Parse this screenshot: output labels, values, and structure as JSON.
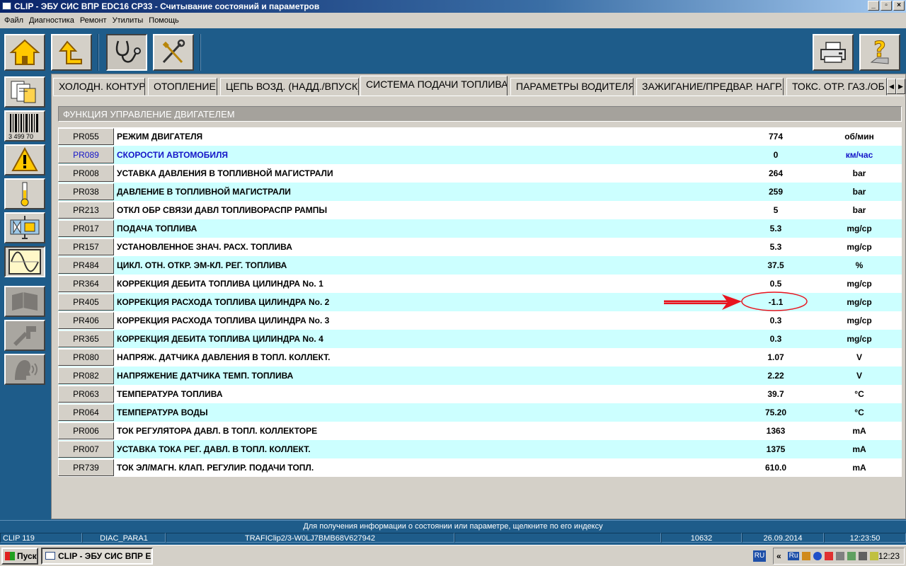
{
  "window": {
    "title": "CLIP - ЭБУ СИС ВПР EDC16 CP33 - Считывание состояний и параметров",
    "minimize": "_",
    "maximize": "▫",
    "close": "×"
  },
  "menu": [
    "Файл",
    "Диагностика",
    "Ремонт",
    "Утилиты",
    "Помощь"
  ],
  "toolbar_icons": [
    "home-icon",
    "back-arrow-icon",
    "stethoscope-icon",
    "tools-icon",
    "printer-icon",
    "help-icon"
  ],
  "sidebar_icons": [
    "documents-icon",
    "barcode-icon",
    "warning-icon",
    "thermometer-icon",
    "actuator-icon",
    "oscilloscope-icon",
    "book-icon",
    "repair-icon",
    "voice-icon"
  ],
  "barcode_text": "3 499 70",
  "tabs": [
    "ХОЛОДН. КОНТУР",
    "ОТОПЛЕНИЕ",
    "ЦЕПЬ ВОЗД. (НАДД./ВПУСК)",
    "СИСТЕМА ПОДАЧИ ТОПЛИВА",
    "ПАРАМЕТРЫ ВОДИТЕЛЯ",
    "ЗАЖИГАНИЕ/ПРЕДВАР. НАГР.",
    "ТОКС. ОТР. ГАЗ./ОБ"
  ],
  "active_tab": "СИСТЕМА ПОДАЧИ ТОПЛИВА",
  "function_header": "ФУНКЦИЯ УПРАВЛЕНИЕ ДВИГАТЕЛЕМ",
  "params": [
    {
      "code": "PR055",
      "label": "РЕЖИМ ДВИГАТЕЛЯ",
      "value": "774",
      "unit": "об/мин"
    },
    {
      "code": "PR089",
      "label": "СКОРОСТИ АВТОМОБИЛЯ",
      "value": "0",
      "unit": "км/час",
      "highlight": true
    },
    {
      "code": "PR008",
      "label": "УСТАВКА ДАВЛЕНИЯ В ТОПЛИВНОЙ МАГИСТРАЛИ",
      "value": "264",
      "unit": "bar"
    },
    {
      "code": "PR038",
      "label": "ДАВЛЕНИЕ В ТОПЛИВНОЙ МАГИСТРАЛИ",
      "value": "259",
      "unit": "bar"
    },
    {
      "code": "PR213",
      "label": "ОТКЛ ОБР СВЯЗИ ДАВЛ ТОПЛИВОРАСПР РАМПЫ",
      "value": "5",
      "unit": "bar"
    },
    {
      "code": "PR017",
      "label": "ПОДАЧА ТОПЛИВА",
      "value": "5.3",
      "unit": "mg/cp"
    },
    {
      "code": "PR157",
      "label": "УСТАНОВЛЕННОЕ ЗНАЧ. РАСХ. ТОПЛИВА",
      "value": "5.3",
      "unit": "mg/cp"
    },
    {
      "code": "PR484",
      "label": "ЦИКЛ. ОТН. ОТКР. ЭМ-КЛ. РЕГ. ТОПЛИВА",
      "value": "37.5",
      "unit": "%"
    },
    {
      "code": "PR364",
      "label": "КОРРЕКЦИЯ ДЕБИТА ТОПЛИВА ЦИЛИНДРА No. 1",
      "value": "0.5",
      "unit": "mg/cp"
    },
    {
      "code": "PR405",
      "label": "КОРРЕКЦИЯ РАСХОДА ТОПЛИВА ЦИЛИНДРА No. 2",
      "value": "-1.1",
      "unit": "mg/cp"
    },
    {
      "code": "PR406",
      "label": "КОРРЕКЦИЯ РАСХОДА ТОПЛИВА ЦИЛИНДРА No. 3",
      "value": "0.3",
      "unit": "mg/cp"
    },
    {
      "code": "PR365",
      "label": "КОРРЕКЦИЯ ДЕБИТА ТОПЛИВА ЦИЛИНДРА No. 4",
      "value": "0.3",
      "unit": "mg/cp"
    },
    {
      "code": "PR080",
      "label": "НАПРЯЖ. ДАТЧИКА ДАВЛЕНИЯ В ТОПЛ. КОЛЛЕКТ.",
      "value": "1.07",
      "unit": "V"
    },
    {
      "code": "PR082",
      "label": "НАПРЯЖЕНИЕ ДАТЧИКА ТЕМП. ТОПЛИВА",
      "value": "2.22",
      "unit": "V"
    },
    {
      "code": "PR063",
      "label": "ТЕМПЕРАТУРА ТОПЛИВА",
      "value": "39.7",
      "unit": "°C"
    },
    {
      "code": "PR064",
      "label": "ТЕМПЕРАТУРА ВОДЫ",
      "value": "75.20",
      "unit": "°C"
    },
    {
      "code": "PR006",
      "label": "ТОК РЕГУЛЯТОРА ДАВЛ. В ТОПЛ. КОЛЛЕКТОРЕ",
      "value": "1363",
      "unit": "mA"
    },
    {
      "code": "PR007",
      "label": "УСТАВКА ТОКА РЕГ. ДАВЛ. В ТОПЛ. КОЛЛЕКТ.",
      "value": "1375",
      "unit": "mA"
    },
    {
      "code": "PR739",
      "label": "ТОК ЭЛ/МАГН. КЛАП. РЕГУЛИР. ПОДАЧИ ТОПЛ.",
      "value": "610.0",
      "unit": "mA"
    }
  ],
  "annotation": {
    "marked_code": "PR405",
    "color": "#e8141e"
  },
  "status_message": "Для получения информации о состоянии или параметре, щелкните по его индексу",
  "statusbar": {
    "version": "CLIP 119",
    "module": "DIAC_PARA1",
    "vehicle": "TRAFIClip2/3-W0LJ7BMB68V627942",
    "field4": "",
    "code": "10632",
    "date": "26.09.2014",
    "time": "12:23:50"
  },
  "taskbar": {
    "start": "Пуск",
    "task": "CLIP - ЭБУ СИС ВПР Е...",
    "lang": "RU",
    "tray_chevron": "«",
    "tray_lang": "Ru",
    "clock": "12:23"
  },
  "colors": {
    "background": "#1e5c8a",
    "panel": "#d4d0c8",
    "row_alt": "#ccffff",
    "highlight_text": "#1414c8"
  }
}
